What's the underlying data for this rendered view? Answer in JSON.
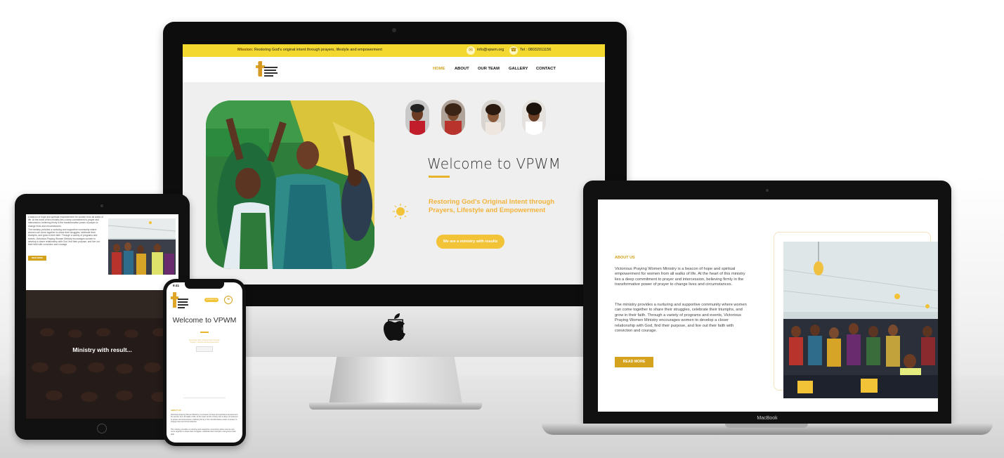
{
  "desktop": {
    "topbar": {
      "mission_label": "Mission:",
      "mission_text": "Restoring God's original intent through prayers, lifestyle and empowerment",
      "email": "info@vpwm.org",
      "phone": "Tel : 08032011156"
    },
    "nav": [
      "HOME",
      "ABOUT",
      "OUR TEAM",
      "GALLERY",
      "CONTACT"
    ],
    "active_nav": "HOME",
    "hero": {
      "title": "Welcome to VPWM",
      "tagline": "Restoring God's Original Intent through Prayers, Lifestyle and Empowerment",
      "cta": "We are a ministry with results"
    },
    "colors": {
      "accent": "#F3D82F",
      "gold": "#D4A21C",
      "tagline": "#F2B33A"
    }
  },
  "tablet": {
    "para1": "a beacon of hope and spiritual empowerment for women from all walks of life. At the heart of this ministry lies a deep commitment to prayer and intercession, believing firmly in the transformative power of prayer to change lives and circumstances.",
    "para2": "The ministry provides a nurturing and supportive community where women can come together to share their struggles, celebrate their triumphs, and grow in their faith. Through a variety of programs and events, Victorious Praying Women Ministry encourages women to develop a closer relationship with God, find their purpose, and live out their faith with conviction and courage.",
    "read_more": "READ MORE",
    "banner": "Ministry with result..."
  },
  "phone": {
    "time": "9:41",
    "pill": "CONTACT US",
    "welcome": "Welcome to VPWM",
    "section": "ABOUT US",
    "para1": "Victorious Praying Women Ministry is a beacon of hope and spiritual empowerment for women from all walks of life. At the heart of this ministry lies a deep commitment to prayer and intercession, believing firmly in the transformative power of prayer to change lives and circumstances.",
    "para2": "The ministry provides a nurturing and supportive community where women can come together to share their struggles, celebrate their triumphs, and grow in their faith."
  },
  "laptop": {
    "brand": "MacBook",
    "about_title": "ABOUT US",
    "para1": "Victorious Praying Women Ministry is a beacon of hope and spiritual empowerment for women from all walks of life. At the heart of this ministry lies a deep commitment to prayer and intercession, believing firmly in the transformative power of prayer to change lives and circumstances.",
    "para2": "The ministry provides a nurturing and supportive community where women can come together to share their struggles, celebrate their triumphs, and grow in their faith. Through a variety of programs and events, Victorious Praying Women Ministry encourages women to develop a closer relationship with God, find their purpose, and live out their faith with conviction and courage.",
    "button": "READ MORE"
  },
  "icons": [
    "apple-logo-icon",
    "email-icon",
    "phone-icon",
    "sun-icon",
    "menu-icon",
    "cross-logo-icon"
  ]
}
